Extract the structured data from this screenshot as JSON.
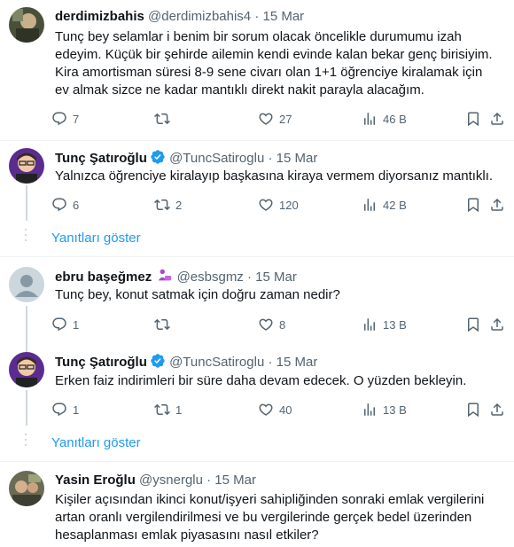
{
  "tweets": [
    {
      "name": "derdimizbahis",
      "handle": "@derdimizbahis4",
      "date": "· 15 Mar",
      "text": "Tunç bey selamlar i benim bir sorum olacak öncelikle durumumu izah edeyim. Küçük bir şehirde ailemin kendi evinde kalan bekar genç birisiyim. Kira amortisman süresi 8-9 sene civarı olan 1+1 öğrenciye kiralamak için ev almak sizce ne kadar mantıklı direkt nakit parayla alacağım.",
      "replies": "7",
      "retweets": "",
      "likes": "27",
      "views": "46 B"
    },
    {
      "name": "Tunç Şatıroğlu",
      "handle": "@TuncSatiroglu",
      "date": "· 15 Mar",
      "text": "Yalnızca öğrenciye kiralayıp başkasına kiraya vermem diyorsanız mantıklı.",
      "replies": "6",
      "retweets": "2",
      "likes": "120",
      "views": "42 B"
    },
    {
      "name": "ebru başeğmez",
      "handle": "@esbsgmz",
      "date": "· 15 Mar",
      "text": "Tunç bey, konut satmak için doğru zaman nedir?",
      "replies": "1",
      "retweets": "",
      "likes": "8",
      "views": "13 B"
    },
    {
      "name": "Tunç Şatıroğlu",
      "handle": "@TuncSatiroglu",
      "date": "· 15 Mar",
      "text": "Erken faiz indirimleri bir süre daha devam edecek. O yüzden bekleyin.",
      "replies": "1",
      "retweets": "1",
      "likes": "40",
      "views": "13 B"
    },
    {
      "name": "Yasin Eroğlu",
      "handle": "@ysnerglu",
      "date": "· 15 Mar",
      "text": "Kişiler açısından ikinci konut/işyeri sahipliğinden sonraki emlak vergilerini artan oranlı vergilendirilmesi ve bu vergilerinde gerçek bedel üzerinden hesaplanması emlak piyasasını nasıl etkiler?"
    }
  ],
  "show_replies_label": "Yanıtları göster",
  "colors": {
    "link": "#1d9bf0",
    "verified": "#1d9bf0",
    "muted": "#536471",
    "border": "#eff3f4"
  },
  "icons": [
    "reply-icon",
    "retweet-icon",
    "like-icon",
    "views-icon",
    "bookmark-icon",
    "share-icon",
    "verified-badge-icon",
    "woman-technologist-emoji"
  ]
}
